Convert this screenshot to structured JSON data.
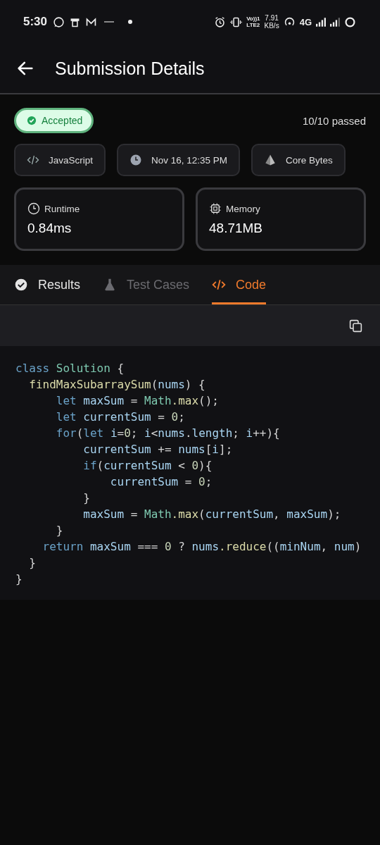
{
  "status_bar": {
    "time": "5:30",
    "volte": "Vo))1",
    "lte": "LTE2",
    "speed": "7.91",
    "speed_unit": "KB/s",
    "network": "4G"
  },
  "header": {
    "title": "Submission Details"
  },
  "status": {
    "label": "Accepted",
    "passed": "10/10 passed"
  },
  "chips": [
    {
      "kind": "code",
      "label": "JavaScript"
    },
    {
      "kind": "clock",
      "label": "Nov 16, 12:35 PM"
    },
    {
      "kind": "pyramid",
      "label": "Core Bytes"
    }
  ],
  "metrics": [
    {
      "kind": "clock",
      "label": "Runtime",
      "value": "0.84ms"
    },
    {
      "kind": "chip",
      "label": "Memory",
      "value": "48.71MB"
    }
  ],
  "tabs": [
    {
      "kind": "check",
      "label": "Results",
      "selected": false,
      "disabled": false
    },
    {
      "kind": "flask",
      "label": "Test Cases",
      "selected": false,
      "disabled": true
    },
    {
      "kind": "code",
      "label": "Code",
      "selected": true,
      "disabled": false
    }
  ],
  "code": [
    [
      {
        "text": "class ",
        "kind": "keyword"
      },
      {
        "text": "Solution",
        "kind": "type"
      },
      {
        "text": " {",
        "kind": "punct"
      }
    ],
    [
      {
        "text": "  findMaxSubarraySum",
        "kind": "function"
      },
      {
        "text": "(",
        "kind": "punct"
      },
      {
        "text": "nums",
        "kind": "variable"
      },
      {
        "text": ") {",
        "kind": "punct"
      }
    ],
    [
      {
        "text": "      let ",
        "kind": "keyword"
      },
      {
        "text": "maxSum",
        "kind": "variable"
      },
      {
        "text": " = ",
        "kind": "punct"
      },
      {
        "text": "Math",
        "kind": "type"
      },
      {
        "text": ".max",
        "kind": "function"
      },
      {
        "text": "();",
        "kind": "punct"
      }
    ],
    [
      {
        "text": "      let ",
        "kind": "keyword"
      },
      {
        "text": "currentSum",
        "kind": "variable"
      },
      {
        "text": " = ",
        "kind": "punct"
      },
      {
        "text": "0",
        "kind": "number"
      },
      {
        "text": ";",
        "kind": "punct"
      }
    ],
    [
      {
        "text": "      for",
        "kind": "keyword"
      },
      {
        "text": "(",
        "kind": "punct"
      },
      {
        "text": "let ",
        "kind": "keyword"
      },
      {
        "text": "i",
        "kind": "variable"
      },
      {
        "text": "=",
        "kind": "punct"
      },
      {
        "text": "0",
        "kind": "number"
      },
      {
        "text": "; ",
        "kind": "punct"
      },
      {
        "text": "i",
        "kind": "variable"
      },
      {
        "text": "<",
        "kind": "punct"
      },
      {
        "text": "nums",
        "kind": "variable"
      },
      {
        "text": ".",
        "kind": "punct"
      },
      {
        "text": "length",
        "kind": "variable"
      },
      {
        "text": "; ",
        "kind": "punct"
      },
      {
        "text": "i",
        "kind": "variable"
      },
      {
        "text": "++){",
        "kind": "punct"
      }
    ],
    [
      {
        "text": "          currentSum",
        "kind": "variable"
      },
      {
        "text": " += ",
        "kind": "punct"
      },
      {
        "text": "nums",
        "kind": "variable"
      },
      {
        "text": "[",
        "kind": "punct"
      },
      {
        "text": "i",
        "kind": "variable"
      },
      {
        "text": "];",
        "kind": "punct"
      }
    ],
    [
      {
        "text": "          if",
        "kind": "keyword"
      },
      {
        "text": "(",
        "kind": "punct"
      },
      {
        "text": "currentSum",
        "kind": "variable"
      },
      {
        "text": " < ",
        "kind": "punct"
      },
      {
        "text": "0",
        "kind": "number"
      },
      {
        "text": "){",
        "kind": "punct"
      }
    ],
    [
      {
        "text": "              currentSum",
        "kind": "variable"
      },
      {
        "text": " = ",
        "kind": "punct"
      },
      {
        "text": "0",
        "kind": "number"
      },
      {
        "text": ";",
        "kind": "punct"
      }
    ],
    [
      {
        "text": "          }",
        "kind": "punct"
      }
    ],
    [
      {
        "text": "          maxSum",
        "kind": "variable"
      },
      {
        "text": " = ",
        "kind": "punct"
      },
      {
        "text": "Math",
        "kind": "type"
      },
      {
        "text": ".max",
        "kind": "function"
      },
      {
        "text": "(",
        "kind": "punct"
      },
      {
        "text": "currentSum",
        "kind": "variable"
      },
      {
        "text": ", ",
        "kind": "punct"
      },
      {
        "text": "maxSum",
        "kind": "variable"
      },
      {
        "text": ");",
        "kind": "punct"
      }
    ],
    [
      {
        "text": "      }",
        "kind": "punct"
      }
    ],
    [
      {
        "text": "    return ",
        "kind": "keyword"
      },
      {
        "text": "maxSum",
        "kind": "variable"
      },
      {
        "text": " === ",
        "kind": "punct"
      },
      {
        "text": "0",
        "kind": "number"
      },
      {
        "text": " ? ",
        "kind": "punct"
      },
      {
        "text": "nums",
        "kind": "variable"
      },
      {
        "text": ".reduce",
        "kind": "function"
      },
      {
        "text": "((",
        "kind": "punct"
      },
      {
        "text": "minNum",
        "kind": "variable"
      },
      {
        "text": ", ",
        "kind": "punct"
      },
      {
        "text": "num",
        "kind": "variable"
      },
      {
        "text": ")",
        "kind": "punct"
      }
    ],
    [
      {
        "text": "  }",
        "kind": "punct"
      }
    ],
    [
      {
        "text": "}",
        "kind": "punct"
      }
    ]
  ]
}
